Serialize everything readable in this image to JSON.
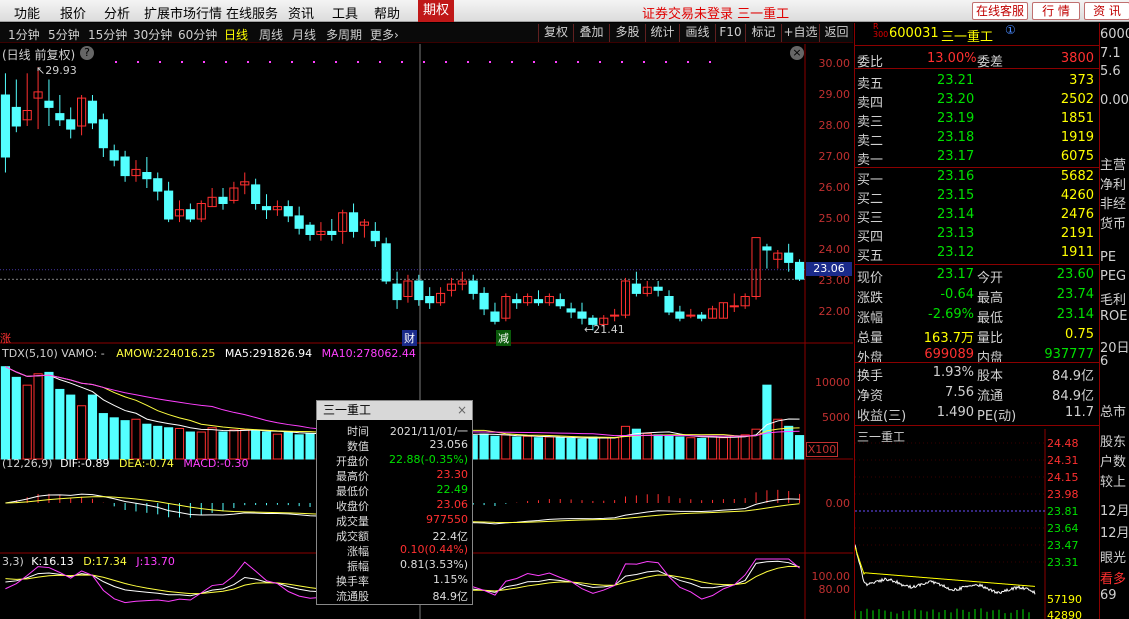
{
  "menu": {
    "items": [
      "功能",
      "报价",
      "分析",
      "扩展市场行情",
      "在线服务",
      "资讯",
      "工具",
      "帮助"
    ],
    "active": "期权",
    "status": "证券交易未登录  三一重工",
    "buttons": [
      "在线客服",
      "行  情",
      "资  讯"
    ]
  },
  "period_bar": {
    "periods": [
      "1分钟",
      "5分钟",
      "15分钟",
      "30分钟",
      "60分钟",
      "日线",
      "周线",
      "月线",
      "多周期",
      "更多"
    ],
    "more_arrow": "›",
    "right_buttons": [
      "复权",
      "叠加",
      "多股",
      "统计",
      "画线",
      "F10",
      "标记",
      "+自选",
      "返回"
    ],
    "active_period": "日线"
  },
  "chart_header": {
    "title": "(日线 前复权)",
    "help": "?"
  },
  "price_chart": {
    "y_labels": [
      "30.00",
      "29.00",
      "28.00",
      "27.00",
      "26.00",
      "25.00",
      "24.00",
      "23.00",
      "22.00"
    ],
    "current_price_label": "23.06",
    "high_marker": "29.93",
    "low_marker": "21.41",
    "marker_cai": "财",
    "marker_jian": "减",
    "marker_left": "涨"
  },
  "chart_data": [
    {
      "type": "candlestick",
      "title": "日线 前复权",
      "y_axis": [
        22.0,
        30.0
      ],
      "high": 29.93,
      "low": 21.41,
      "last": 23.06,
      "candles": [
        [
          29.0,
          29.7,
          27.0,
          26.5
        ],
        [
          28.6,
          29.5,
          28.0,
          27.8
        ],
        [
          28.2,
          29.7,
          28.5,
          28.0
        ],
        [
          28.9,
          29.9,
          29.1,
          27.9
        ],
        [
          28.8,
          29.5,
          28.6,
          28.0
        ],
        [
          28.4,
          29.0,
          28.2,
          28.0
        ],
        [
          28.2,
          28.6,
          27.9,
          27.6
        ],
        [
          28.0,
          29.0,
          28.9,
          27.7
        ],
        [
          28.8,
          29.0,
          28.1,
          27.9
        ],
        [
          28.2,
          28.4,
          27.3,
          27.0
        ],
        [
          27.2,
          27.4,
          26.9,
          26.7
        ],
        [
          27.0,
          27.2,
          26.4,
          26.2
        ],
        [
          26.4,
          26.9,
          26.6,
          26.2
        ],
        [
          26.5,
          27.0,
          26.3,
          26.0
        ],
        [
          26.3,
          26.5,
          25.9,
          25.6
        ],
        [
          25.9,
          26.2,
          25.0,
          24.9
        ],
        [
          25.1,
          25.6,
          25.3,
          24.9
        ],
        [
          25.3,
          25.5,
          25.0,
          24.9
        ],
        [
          25.0,
          25.6,
          25.5,
          24.9
        ],
        [
          25.4,
          26.0,
          25.7,
          25.4
        ],
        [
          25.7,
          26.0,
          25.5,
          25.3
        ],
        [
          25.6,
          26.2,
          26.0,
          25.5
        ],
        [
          26.1,
          26.5,
          26.2,
          25.8
        ],
        [
          26.1,
          26.3,
          25.5,
          25.3
        ],
        [
          25.4,
          25.8,
          25.3,
          25.0
        ],
        [
          25.3,
          25.6,
          25.4,
          25.1
        ],
        [
          25.4,
          25.6,
          25.1,
          24.9
        ],
        [
          25.1,
          25.4,
          24.7,
          24.5
        ],
        [
          24.8,
          24.9,
          24.5,
          24.3
        ],
        [
          24.5,
          24.9,
          24.6,
          24.3
        ],
        [
          24.6,
          25.0,
          24.5,
          24.3
        ],
        [
          24.6,
          25.3,
          25.2,
          24.2
        ],
        [
          25.2,
          25.5,
          24.6,
          24.4
        ],
        [
          24.8,
          25.0,
          24.9,
          24.4
        ],
        [
          24.6,
          24.9,
          24.3,
          24.1
        ],
        [
          24.2,
          24.4,
          23.0,
          22.9
        ],
        [
          22.9,
          23.3,
          22.4,
          22.1
        ],
        [
          22.5,
          23.2,
          23.0,
          22.3
        ],
        [
          23.0,
          23.2,
          22.4,
          22.2
        ],
        [
          22.5,
          22.8,
          22.3,
          22.1
        ],
        [
          22.3,
          22.8,
          22.6,
          22.2
        ],
        [
          22.7,
          23.1,
          22.9,
          22.5
        ],
        [
          22.9,
          23.3,
          23.0,
          22.7
        ],
        [
          23.0,
          23.2,
          22.6,
          22.4
        ],
        [
          22.6,
          22.8,
          22.1,
          21.9
        ],
        [
          22.0,
          22.3,
          21.7,
          21.6
        ],
        [
          21.8,
          22.6,
          22.5,
          21.7
        ],
        [
          22.4,
          22.6,
          22.3,
          22.1
        ],
        [
          22.3,
          22.6,
          22.5,
          22.2
        ],
        [
          22.4,
          22.7,
          22.3,
          22.2
        ],
        [
          22.3,
          22.6,
          22.5,
          22.2
        ],
        [
          22.4,
          22.6,
          22.2,
          22.1
        ],
        [
          22.1,
          22.3,
          22.0,
          21.8
        ],
        [
          22.0,
          22.3,
          21.8,
          21.6
        ],
        [
          21.8,
          21.9,
          21.6,
          21.41
        ],
        [
          21.6,
          21.9,
          21.8,
          21.5
        ],
        [
          21.9,
          22.1,
          21.9,
          21.7
        ],
        [
          21.9,
          23.1,
          23.0,
          21.8
        ],
        [
          22.9,
          23.3,
          22.6,
          22.5
        ],
        [
          22.6,
          23.0,
          22.8,
          22.5
        ],
        [
          22.8,
          23.0,
          22.7,
          22.5
        ],
        [
          22.5,
          22.7,
          22.0,
          21.9
        ],
        [
          22.0,
          22.2,
          21.8,
          21.7
        ],
        [
          21.9,
          22.1,
          21.9,
          21.8
        ],
        [
          21.9,
          22.0,
          21.8,
          21.7
        ],
        [
          21.8,
          22.2,
          22.1,
          21.8
        ],
        [
          21.8,
          22.3,
          22.3,
          21.8
        ],
        [
          22.2,
          22.6,
          22.2,
          22.0
        ],
        [
          22.2,
          22.6,
          22.5,
          22.1
        ],
        [
          22.5,
          23.4,
          24.4,
          22.4
        ],
        [
          24.1,
          24.2,
          24.0,
          23.4
        ],
        [
          23.7,
          24.0,
          23.9,
          23.4
        ],
        [
          23.9,
          24.2,
          23.6,
          23.3
        ],
        [
          23.6,
          23.7,
          23.06,
          23.0
        ]
      ]
    },
    {
      "type": "bar",
      "title": "VOL-TDX(5,10)",
      "ylabels": [
        "10000",
        "5000",
        "X100"
      ],
      "amow": "224016.25",
      "ma5": "291826.94",
      "ma10": "278062.44",
      "values": [
        13000,
        11500,
        10400,
        12000,
        12200,
        9800,
        9000,
        7500,
        9000,
        6400,
        5800,
        5400,
        5600,
        4900,
        4600,
        4400,
        4300,
        3800,
        3800,
        4400,
        3800,
        4100,
        4100,
        4000,
        3800,
        3500,
        3800,
        3400,
        3600,
        3500,
        3600,
        3800,
        3400,
        3600,
        3500,
        5400,
        6000,
        4200,
        4000,
        3300,
        3400,
        3700,
        3600,
        3300,
        3500,
        3200,
        3400,
        3100,
        3200,
        3000,
        3100,
        3000,
        2900,
        2800,
        3100,
        3000,
        3000,
        4600,
        4200,
        3600,
        3400,
        3300,
        3100,
        3000,
        2900,
        3200,
        3000,
        3200,
        3400,
        4200,
        10400,
        5600,
        4600,
        3300
      ]
    },
    {
      "type": "bar",
      "title": "MACD(12,26,9)",
      "dif": "-0.89",
      "dea": "-0.74",
      "macd": "-0.30",
      "zero_label": "0.00"
    },
    {
      "type": "line",
      "title": "KDJ(9,3,3)",
      "k": "16.13",
      "d": "17.34",
      "j": "13.70",
      "ylabels": [
        "100.00",
        "80.00"
      ]
    }
  ],
  "indicator_labels": {
    "vol_prefix": "TDX(5,10)  VAMO: -",
    "amow_label": "AMOW:",
    "ma5_label": "MA5:",
    "ma10_label": "MA10:",
    "macd_prefix": "(12,26,9)",
    "dif_label": "DIF:",
    "dea_label": "DEA:",
    "macd_label": "MACD:",
    "kdj_prefix": "3,3)",
    "k_label": "K:",
    "d_label": "D:",
    "j_label": "J:"
  },
  "popup": {
    "title": "三一重工",
    "close": "×",
    "rows": [
      {
        "k": "时间",
        "v": "2021/11/01/一"
      },
      {
        "k": "数值",
        "v": "23.056"
      },
      {
        "k": "开盘价",
        "v": "22.88(-0.35%)"
      },
      {
        "k": "最高价",
        "v": "23.30"
      },
      {
        "k": "最低价",
        "v": "22.49"
      },
      {
        "k": "收盘价",
        "v": "23.06"
      },
      {
        "k": "成交量",
        "v": "977550"
      },
      {
        "k": "成交额",
        "v": "22.4亿"
      },
      {
        "k": "涨幅",
        "v": "0.10(0.44%)"
      },
      {
        "k": "振幅",
        "v": "0.81(3.53%)"
      },
      {
        "k": "换手率",
        "v": "1.15%"
      },
      {
        "k": "流通股",
        "v": "84.9亿"
      }
    ]
  },
  "quote": {
    "badge": "R\n300",
    "code": "600031",
    "name": "三一重工",
    "circle": "①",
    "weibi": {
      "label": "委比",
      "value": "13.00%",
      "label2": "委差",
      "value2": "3800"
    },
    "sells": [
      {
        "label": "卖五",
        "price": "23.21",
        "vol": "373"
      },
      {
        "label": "卖四",
        "price": "23.20",
        "vol": "2502"
      },
      {
        "label": "卖三",
        "price": "23.19",
        "vol": "1851"
      },
      {
        "label": "卖二",
        "price": "23.18",
        "vol": "1919"
      },
      {
        "label": "卖一",
        "price": "23.17",
        "vol": "6075"
      }
    ],
    "buys": [
      {
        "label": "买一",
        "price": "23.16",
        "vol": "5682"
      },
      {
        "label": "买二",
        "price": "23.15",
        "vol": "4260"
      },
      {
        "label": "买三",
        "price": "23.14",
        "vol": "2476"
      },
      {
        "label": "买四",
        "price": "23.13",
        "vol": "2191"
      },
      {
        "label": "买五",
        "price": "23.12",
        "vol": "1911"
      }
    ],
    "stats": [
      {
        "l1": "现价",
        "v1": "23.17",
        "l2": "今开",
        "v2": "23.60"
      },
      {
        "l1": "涨跌",
        "v1": "-0.64",
        "l2": "最高",
        "v2": "23.74"
      },
      {
        "l1": "涨幅",
        "v1": "-2.69%",
        "l2": "最低",
        "v2": "23.14"
      },
      {
        "l1": "总量",
        "v1": "163.7万",
        "l2": "量比",
        "v2": "0.75"
      },
      {
        "l1": "外盘",
        "v1": "699089",
        "l2": "内盘",
        "v2": "937777"
      }
    ],
    "stats2": [
      {
        "l1": "换手",
        "v1": "1.93%",
        "l2": "股本",
        "v2": "84.9亿"
      },
      {
        "l1": "净资",
        "v1": "7.56",
        "l2": "流通",
        "v2": "84.9亿"
      },
      {
        "l1": "收益(三)",
        "v1": "1.490",
        "l2": "PE(动)",
        "v2": "11.7"
      }
    ]
  },
  "mini_chart": {
    "title": "三一重工",
    "y_labels": [
      "24.48",
      "24.31",
      "24.15",
      "23.98",
      "23.81",
      "23.64",
      "23.47",
      "23.31"
    ],
    "vol_label": "57190",
    "bottom_label": "42890"
  },
  "far_right": {
    "items": [
      "6000",
      "7.1",
      "5.6",
      "0.00",
      "主营",
      "净利",
      "非经",
      "货币",
      "PE",
      "PEG",
      "毛利",
      "ROE",
      "20日",
      "6",
      "总市",
      "股东",
      "户数",
      "较上",
      "12月",
      "12月",
      "眼光",
      "看多",
      "69"
    ]
  },
  "colors": {
    "up": "#ff3030",
    "down": "#54ffff",
    "yellow": "#ffff00",
    "green": "#00e000",
    "ma_white": "#ffffff",
    "ma_yellow": "#ffff40",
    "ma_magenta": "#ff40ff"
  }
}
